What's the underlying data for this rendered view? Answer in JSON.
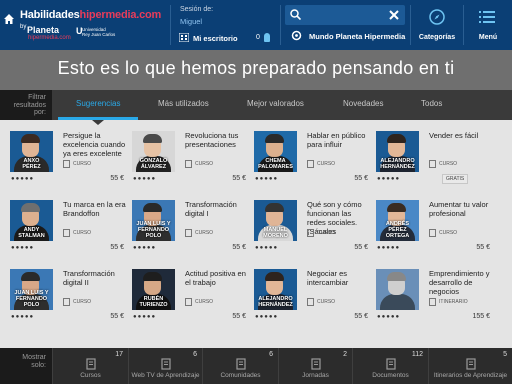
{
  "header": {
    "logo_main": "Habilidades",
    "logo_highlight": "hipermedia.com",
    "logo_by": "by",
    "logo_planeta": "Planeta",
    "logo_hipermedia": "hipermedia.com",
    "logo_u": "U",
    "logo_urjc": "Universidad\nRey Juan Carlos",
    "session_label": "Sesión de:",
    "session_user": "Miguel",
    "desk_label": "Mi escritorio",
    "desk_count": "0",
    "search_placeholder": "",
    "world_label": "Mundo Planeta Hipermedia",
    "categories_label": "Categorías",
    "menu_label": "Menú"
  },
  "hero": {
    "title": "Esto es lo que hemos preparado pensando en ti"
  },
  "filter": {
    "label": "Filtrar\nresultados\npor:",
    "tabs": [
      "Sugerencias",
      "Más utilizados",
      "Mejor valorados",
      "Novedades",
      "Todos"
    ],
    "active_index": 0
  },
  "cards": [
    {
      "name": "ANXO\nPÉREZ",
      "title": "Persigue la excelencia cuando ya eres excelente",
      "type": "CURSO",
      "price": "55 €",
      "stars": 5,
      "free": "",
      "bg": "#1a5a94",
      "skin": "#e0b596",
      "hair": "#3b2a22",
      "shirt": "#2a2a2a"
    },
    {
      "name": "GONZALO\nÁLVAREZ",
      "title": "Revoluciona tus presentaciones",
      "type": "CURSO",
      "price": "55 €",
      "stars": 5,
      "free": "",
      "bg": "#d7d7d7",
      "skin": "#e6c2a4",
      "hair": "#4a4a4a",
      "shirt": "#222222"
    },
    {
      "name": "CHEMA\nPALOMARES",
      "title": "Hablar en público para influir",
      "type": "CURSO",
      "price": "55 €",
      "stars": 5,
      "free": "",
      "bg": "#1f6aa8",
      "skin": "#dcb08e",
      "hair": "#2a2a2a",
      "shirt": "#1a1a1a"
    },
    {
      "name": "ALEJANDRO\nHERNÁNDEZ",
      "title": "Vender es fácil",
      "type": "CURSO",
      "price": "",
      "stars": 5,
      "free": "GRATIS",
      "bg": "#1a5a94",
      "skin": "#e2b797",
      "hair": "#2e241e",
      "shirt": "#1e2430"
    },
    {
      "name": "ANDY\nSTALMAN",
      "title": "Tu marca en la era Brandoffon",
      "type": "CURSO",
      "price": "55 €",
      "stars": 5,
      "free": "",
      "bg": "#1a5a94",
      "skin": "#ddb08f",
      "hair": "#6f6f6f",
      "shirt": "#1b1b1b"
    },
    {
      "name": "JUAN LUIS Y\nFERNANDO\nPOLO",
      "title": "Transformación digital I",
      "type": "CURSO",
      "price": "55 €",
      "stars": 5,
      "free": "",
      "bg": "#3b78b5",
      "skin": "#d9a888",
      "hair": "#2a2a2a",
      "shirt": "#2e2e2e"
    },
    {
      "name": "MANUEL\nMORENO",
      "title": "Qué son y cómo funcionan las redes sociales. ¡Sácales",
      "type": "CURSO",
      "price": "55 €",
      "stars": 5,
      "free": "",
      "bg": "#1a5a94",
      "skin": "#e0b596",
      "hair": "#333333",
      "shirt": "#d8d8d8"
    },
    {
      "name": "ANDRÉS\nPÉREZ ORTEGA",
      "title": "Aumentar tu valor profesional",
      "type": "CURSO",
      "price": "55 €",
      "stars": 5,
      "free": "",
      "bg": "#4a88c6",
      "skin": "#e2b797",
      "hair": "#3a2c22",
      "shirt": "#242c3a"
    },
    {
      "name": "JUAN LUIS Y\nFERNANDO\nPOLO",
      "title": "Transformación digital II",
      "type": "CURSO",
      "price": "55 €",
      "stars": 5,
      "free": "",
      "bg": "#3b78b5",
      "skin": "#d9a888",
      "hair": "#2a2a2a",
      "shirt": "#2e2e2e"
    },
    {
      "name": "RUBÉN\nTURIENZO",
      "title": "Actitud positiva en el trabajo",
      "type": "CURSO",
      "price": "55 €",
      "stars": 5,
      "free": "",
      "bg": "#1f2a3a",
      "skin": "#d6a886",
      "hair": "#1e1e1e",
      "shirt": "#111111"
    },
    {
      "name": "ALEJANDRO\nHERNÁNDEZ",
      "title": "Negociar es intercambiar",
      "type": "CURSO",
      "price": "55 €",
      "stars": 5,
      "free": "",
      "bg": "#1a5a94",
      "skin": "#e2b797",
      "hair": "#2e241e",
      "shirt": "#1e2430"
    },
    {
      "name": "",
      "title": "Emprendimiento y desarrollo de negocios",
      "type": "ITINERARIO",
      "price": "155 €",
      "stars": 5,
      "free": "",
      "bg": "#6a8fb8",
      "skin": "#cfcfcf",
      "hair": "#888888",
      "shirt": "#3a4a5a"
    }
  ],
  "bottom": {
    "label": "Mostrar\nsolo:",
    "items": [
      {
        "label": "Cursos",
        "count": "17",
        "icon": "course-icon"
      },
      {
        "label": "Web TV de Aprendizaje",
        "count": "6",
        "icon": "tv-icon"
      },
      {
        "label": "Comunidades",
        "count": "6",
        "icon": "community-icon"
      },
      {
        "label": "Jornadas",
        "count": "2",
        "icon": "bookmark-icon"
      },
      {
        "label": "Documentos",
        "count": "112",
        "icon": "document-icon"
      },
      {
        "label": "Itinerarios de Aprendizaje",
        "count": "5",
        "icon": "itinerary-icon"
      }
    ]
  },
  "colors": {
    "header": "#0b3f75",
    "accent": "#2aa9e8",
    "brand_pink": "#e83c5a",
    "hero": "#6f6f6f",
    "filter": "#3a3a3a"
  }
}
